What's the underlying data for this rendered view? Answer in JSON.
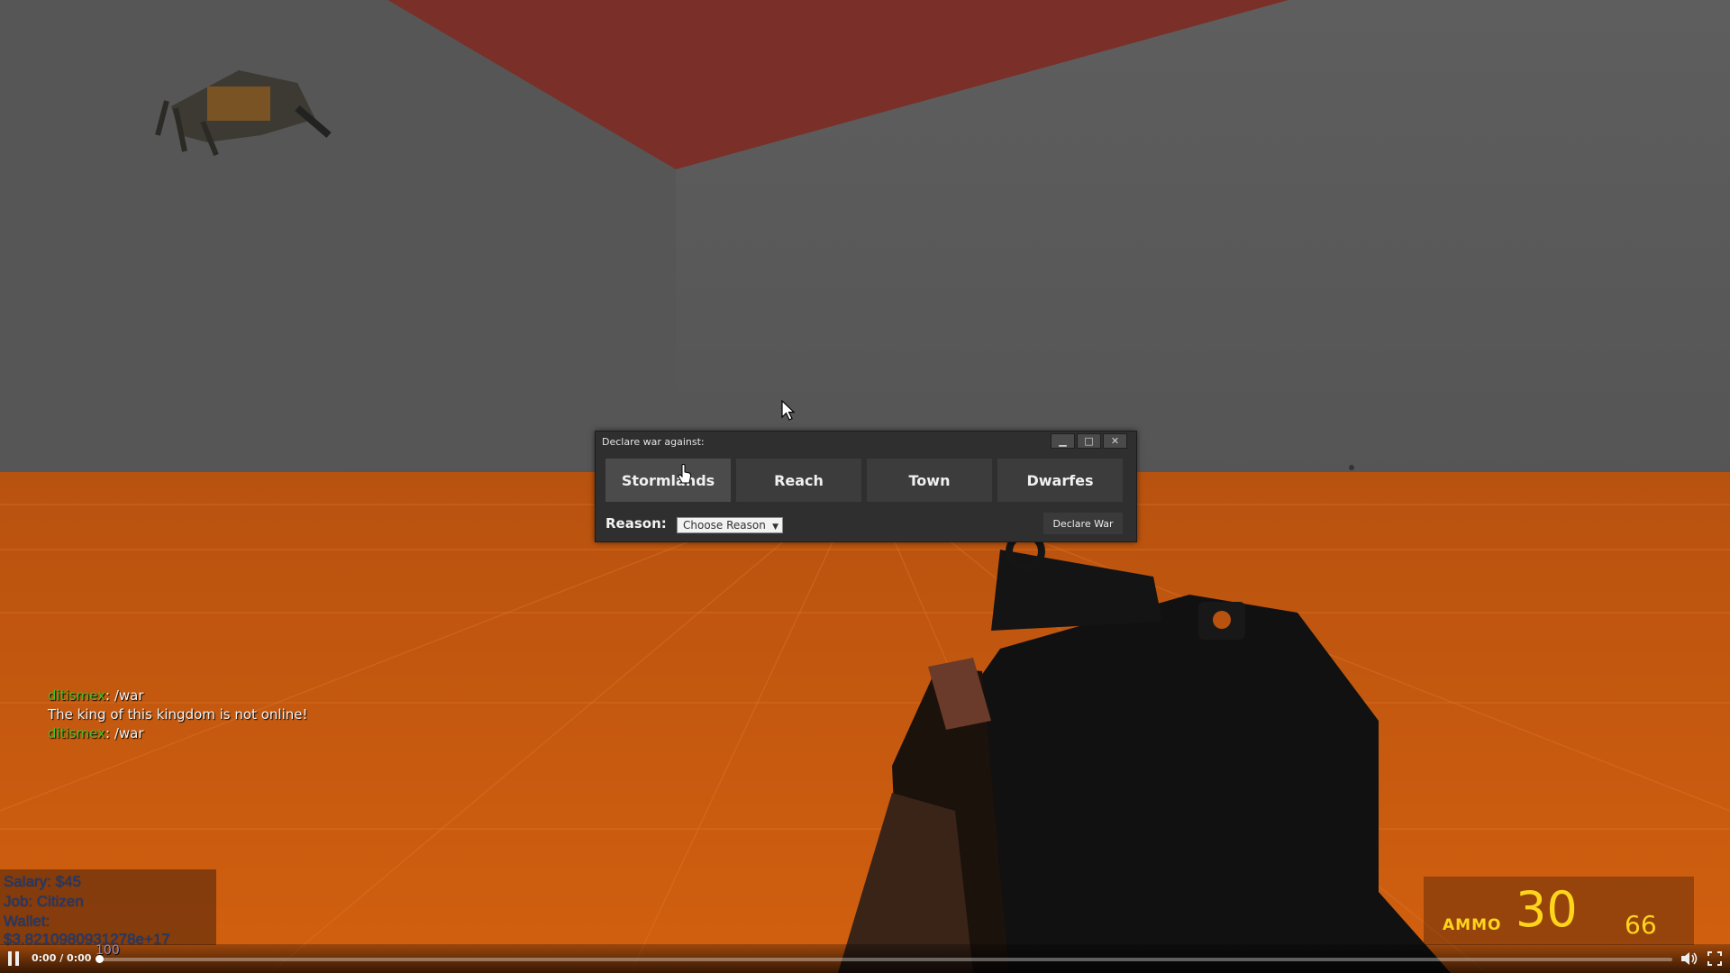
{
  "dialog": {
    "title": "Declare war against:",
    "kingdoms": [
      "Stormlands",
      "Reach",
      "Town",
      "Dwarfes"
    ],
    "reason_label": "Reason:",
    "reason_selected": "Choose Reason",
    "declare_label": "Declare War",
    "icons": {
      "minimize": "minimize-icon",
      "maximize": "maximize-icon",
      "close": "close-icon"
    }
  },
  "chat": [
    {
      "name": "ditismex",
      "text": ": /war"
    },
    {
      "name": "",
      "text": "The king of this kingdom is not online!"
    },
    {
      "name": "ditismex",
      "text": ": /war"
    }
  ],
  "info": {
    "salary": "Salary: $45",
    "job": "Job: Citizen",
    "wallet": "Wallet: $3.8210980931278e+17"
  },
  "ammo": {
    "label": "AMMO",
    "clip": "30",
    "reserve": "66",
    "color": "#ffd51c"
  },
  "video": {
    "time": "0:00 / 0:00",
    "overlay_number": "100",
    "progress": 0,
    "icons": {
      "pause": "pause-icon",
      "volume": "volume-icon",
      "fullscreen": "fullscreen-icon"
    }
  },
  "colors": {
    "floor": "#c85a10",
    "wall": "#5c5c5c",
    "ceiling": "#7a3028",
    "chat_name": "#48c028",
    "info_text": "#1d3c78"
  }
}
